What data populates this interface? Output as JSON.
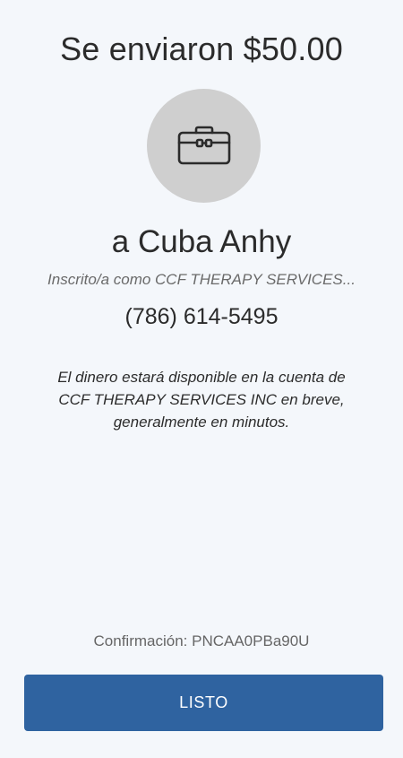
{
  "header": {
    "title": "Se enviaron $50.00"
  },
  "recipient": {
    "avatar_icon": "briefcase-icon",
    "name": "a Cuba Anhy",
    "registered_as": "Inscrito/a como CCF THERAPY SERVICES...",
    "phone": "(786) 614-5495"
  },
  "message": {
    "text": "El dinero estará disponible en la cuenta de CCF THERAPY SERVICES INC en breve, generalmente en minutos."
  },
  "footer": {
    "confirmation": "Confirmación: PNCAA0PBa90U",
    "done_label": "LISTO"
  },
  "colors": {
    "background": "#f4f7fb",
    "avatar_background": "#cfcfcf",
    "button": "#2f63a0",
    "button_text": "#ffffff"
  }
}
